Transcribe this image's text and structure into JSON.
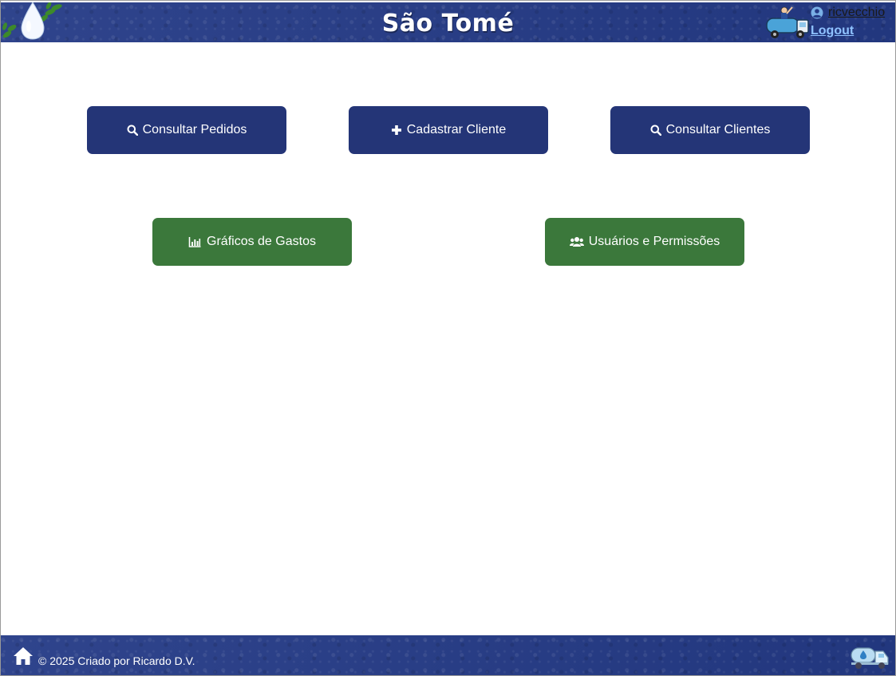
{
  "header": {
    "title": "São Tomé",
    "username": "ricvecchio",
    "logout_label": "Logout",
    "icons": {
      "logo": "water-drop-laurel-logo",
      "mascot": "water-truck-driver-icon",
      "user": "user-circle-icon"
    }
  },
  "menu": {
    "row1": [
      {
        "label": "Consultar Pedidos",
        "icon": "search-icon",
        "color": "#243577"
      },
      {
        "label": "Cadastrar Cliente",
        "icon": "plus-icon",
        "color": "#243577"
      },
      {
        "label": "Consultar Clientes",
        "icon": "search-icon",
        "color": "#243577"
      }
    ],
    "row2": [
      {
        "label": "Gráficos de Gastos",
        "icon": "bar-chart-icon",
        "color": "#3b783b"
      },
      {
        "label": "Usuários e Permissões",
        "icon": "users-icon",
        "color": "#3b783b"
      }
    ]
  },
  "footer": {
    "copyright": "© 2025 Criado por Ricardo D.V.",
    "icons": {
      "home": "home-icon",
      "truck": "water-truck-icon"
    }
  },
  "colors": {
    "bar": "#243a86",
    "primary_button": "#243577",
    "secondary_button": "#3b783b",
    "logout_link": "#8fc2ff"
  }
}
